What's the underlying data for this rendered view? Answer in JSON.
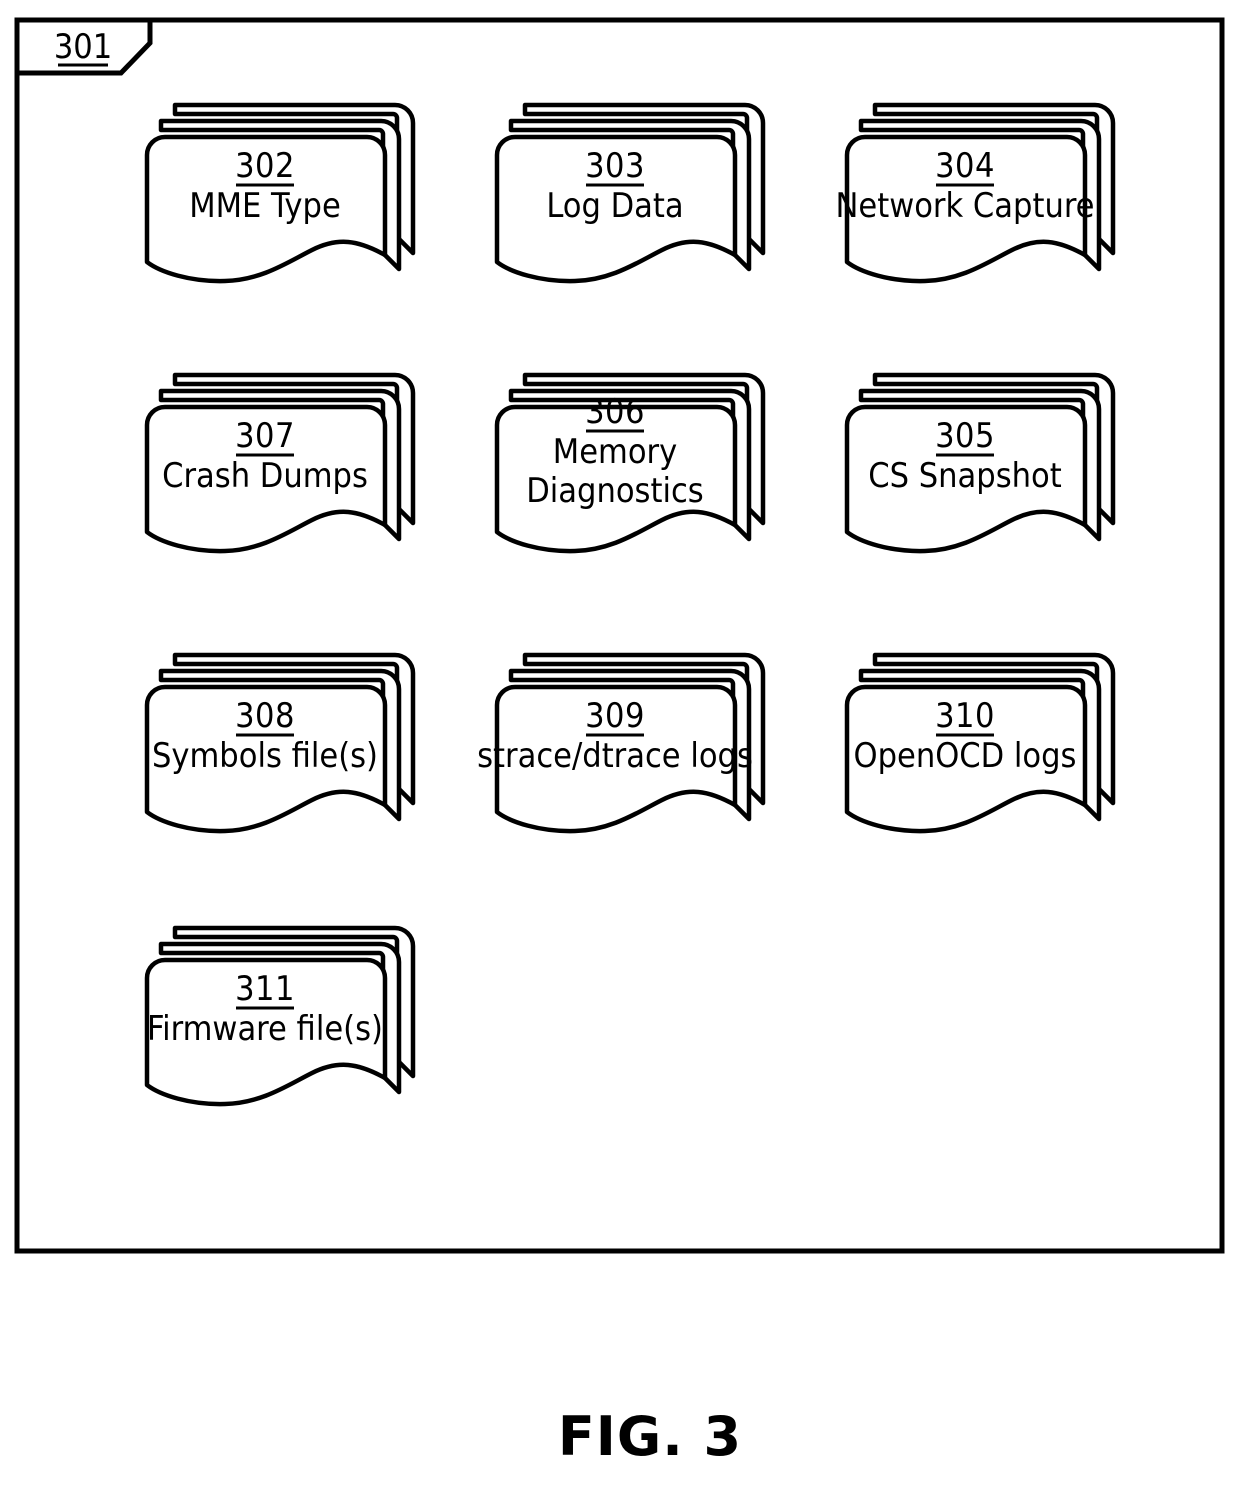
{
  "figure": {
    "caption": "FIG. 3",
    "frame_ref": "301"
  },
  "documents": [
    {
      "ref": "302",
      "label_line1": "MME Type",
      "label_line2": "",
      "row": 0,
      "col": 0
    },
    {
      "ref": "303",
      "label_line1": "Log Data",
      "label_line2": "",
      "row": 0,
      "col": 1
    },
    {
      "ref": "304",
      "label_line1": "Network Capture",
      "label_line2": "",
      "row": 0,
      "col": 2
    },
    {
      "ref": "307",
      "label_line1": "Crash Dumps",
      "label_line2": "",
      "row": 1,
      "col": 0
    },
    {
      "ref": "306",
      "label_line1": "Memory",
      "label_line2": "Diagnostics",
      "row": 1,
      "col": 1
    },
    {
      "ref": "305",
      "label_line1": "CS Snapshot",
      "label_line2": "",
      "row": 1,
      "col": 2
    },
    {
      "ref": "308",
      "label_line1": "Symbols file(s)",
      "label_line2": "",
      "row": 2,
      "col": 0
    },
    {
      "ref": "309",
      "label_line1": "strace/dtrace logs",
      "label_line2": "",
      "row": 2,
      "col": 1
    },
    {
      "ref": "310",
      "label_line1": "OpenOCD logs",
      "label_line2": "",
      "row": 2,
      "col": 2
    },
    {
      "ref": "311",
      "label_line1": "Firmware file(s)",
      "label_line2": "",
      "row": 3,
      "col": 0
    }
  ],
  "colors": {
    "line": "#000000",
    "fill": "#ffffff",
    "background": "#ffffff"
  }
}
